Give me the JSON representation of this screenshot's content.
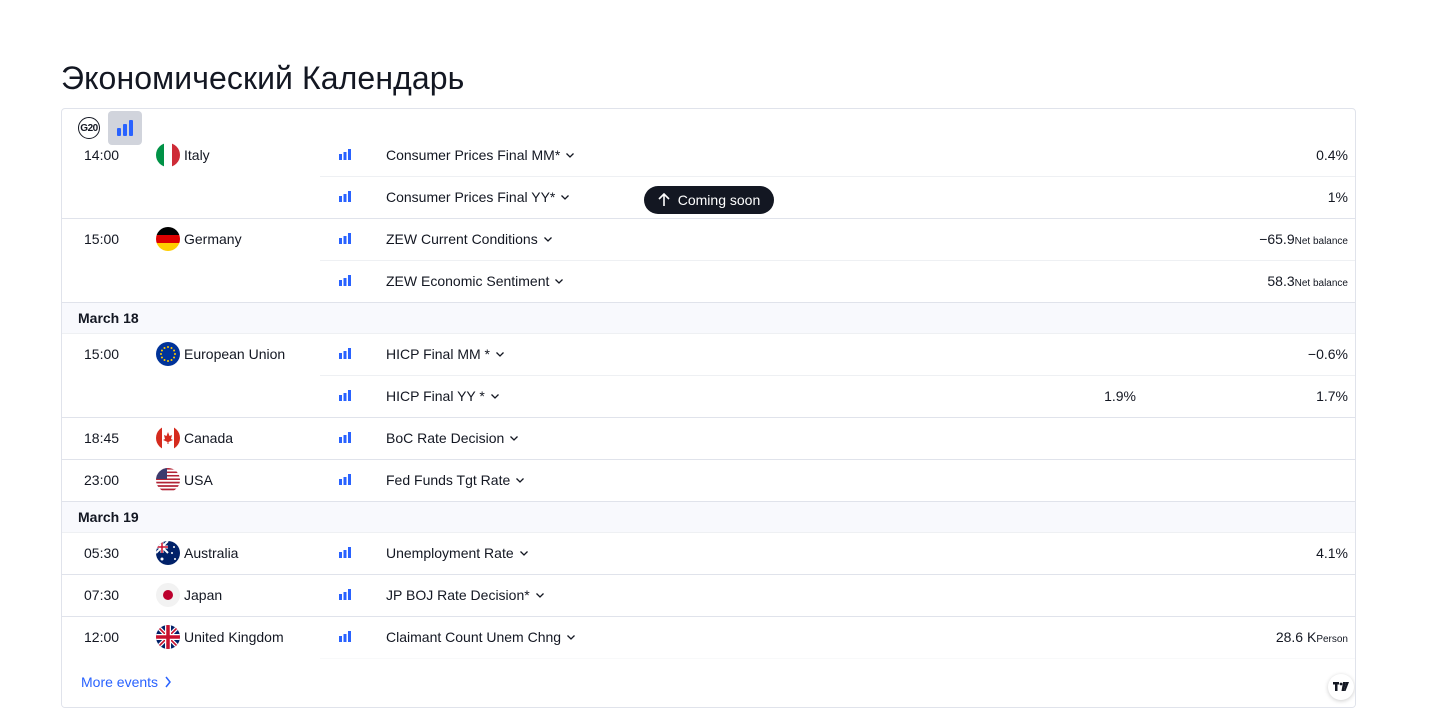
{
  "page": {
    "title": "Экономический Календарь"
  },
  "filters": {
    "g20_label": "G20"
  },
  "tooltip": {
    "label": "Coming soon"
  },
  "groups": [
    {
      "date": "",
      "entries": [
        {
          "time": "14:00",
          "country": "Italy",
          "flag": "it",
          "events": [
            {
              "name": "Consumer Prices Final MM*",
              "forecast": "",
              "actual": "0.4%",
              "unit": ""
            },
            {
              "name": "Consumer Prices Final YY*",
              "forecast": "",
              "actual": "1%",
              "unit": ""
            }
          ]
        },
        {
          "time": "15:00",
          "country": "Germany",
          "flag": "de",
          "events": [
            {
              "name": "ZEW Current Conditions",
              "forecast": "",
              "actual": "−65.9",
              "unit": "Net balance"
            },
            {
              "name": "ZEW Economic Sentiment",
              "forecast": "",
              "actual": "58.3",
              "unit": "Net balance"
            }
          ]
        }
      ]
    },
    {
      "date": "March 18",
      "entries": [
        {
          "time": "15:00",
          "country": "European Union",
          "flag": "eu",
          "events": [
            {
              "name": "HICP Final MM *",
              "forecast": "",
              "actual": "−0.6%",
              "unit": ""
            },
            {
              "name": "HICP Final YY *",
              "forecast": "1.9%",
              "actual": "1.7%",
              "unit": ""
            }
          ]
        },
        {
          "time": "18:45",
          "country": "Canada",
          "flag": "ca",
          "events": [
            {
              "name": "BoC Rate Decision",
              "forecast": "",
              "actual": "",
              "unit": ""
            }
          ]
        },
        {
          "time": "23:00",
          "country": "USA",
          "flag": "us",
          "events": [
            {
              "name": "Fed Funds Tgt Rate",
              "forecast": "",
              "actual": "",
              "unit": ""
            }
          ]
        }
      ]
    },
    {
      "date": "March 19",
      "entries": [
        {
          "time": "05:30",
          "country": "Australia",
          "flag": "au",
          "events": [
            {
              "name": "Unemployment Rate",
              "forecast": "",
              "actual": "4.1%",
              "unit": ""
            }
          ]
        },
        {
          "time": "07:30",
          "country": "Japan",
          "flag": "jp",
          "events": [
            {
              "name": "JP BOJ Rate Decision*",
              "forecast": "",
              "actual": "",
              "unit": ""
            }
          ]
        },
        {
          "time": "12:00",
          "country": "United Kingdom",
          "flag": "gb",
          "events": [
            {
              "name": "Claimant Count Unem Chng",
              "forecast": "",
              "actual": "28.6 K",
              "unit": "Person"
            },
            {
              "name": "",
              "forecast": "",
              "actual": "",
              "unit": ""
            }
          ]
        }
      ]
    }
  ],
  "footer": {
    "more_events": "More events",
    "logo": "TV"
  },
  "colors": {
    "accent": "#2962ff",
    "importance": "#2962ff",
    "text": "#131722",
    "date_bg": "#f8f9fd"
  }
}
